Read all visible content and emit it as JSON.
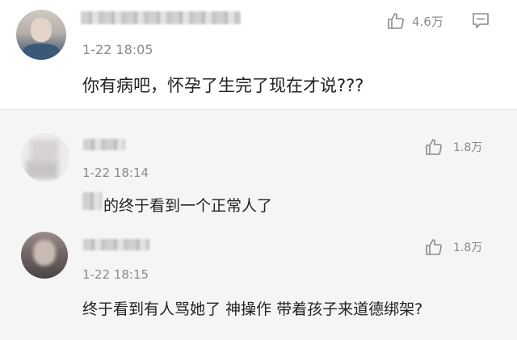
{
  "main_comment": {
    "time": "1-22 18:05",
    "like_count": "4.6万",
    "text": "你有病吧，怀孕了生完了现在才说???"
  },
  "replies": [
    {
      "time": "1-22 18:14",
      "like_count": "1.8万",
      "text": "的终于看到一个正常人了"
    },
    {
      "time": "1-22 18:15",
      "like_count": "1.8万",
      "text": "终于看到有人骂她了 神操作 带着孩子来道德绑架?"
    }
  ],
  "icons": {
    "like": "thumbs-up-icon",
    "reply": "comment-icon"
  },
  "colors": {
    "text_primary": "#222222",
    "text_secondary": "#8a8a8a",
    "reply_panel_bg": "#f5f5f5"
  }
}
